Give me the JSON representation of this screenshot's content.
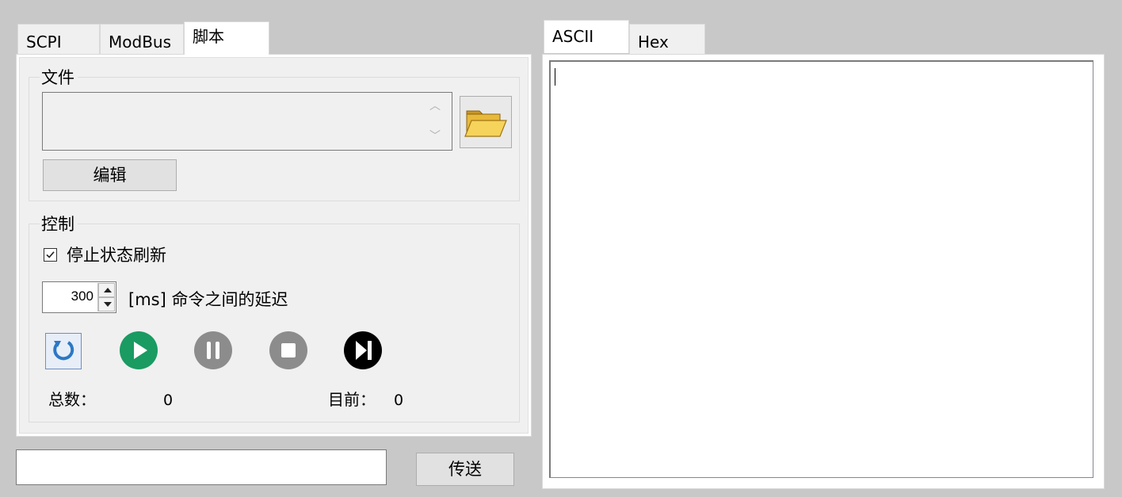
{
  "left_tabs": [
    {
      "label": "SCPI",
      "active": false
    },
    {
      "label": "ModBus",
      "active": false
    },
    {
      "label": "脚本",
      "active": true
    }
  ],
  "file_group": {
    "title": "文件",
    "file_value": "",
    "folder_icon": "folder-open-icon",
    "edit_label": "编辑"
  },
  "control_group": {
    "title": "控制",
    "stop_refresh": {
      "label": "停止状态刷新",
      "checked": true
    },
    "delay": {
      "value": "300",
      "label": "[ms] 命令之间的延迟"
    },
    "buttons": [
      {
        "name": "refresh-icon",
        "color": "#2b78c5"
      },
      {
        "name": "play-icon",
        "color": "#1a9b62"
      },
      {
        "name": "pause-icon",
        "color": "#8c8c8c"
      },
      {
        "name": "stop-icon",
        "color": "#8c8c8c"
      },
      {
        "name": "step-icon",
        "color": "#000000"
      }
    ],
    "total_label": "总数：",
    "total_value": "0",
    "current_label": "目前：",
    "current_value": "0"
  },
  "send": {
    "input_value": "",
    "button_label": "传送"
  },
  "right_tabs": [
    {
      "label": "ASCII",
      "active": true
    },
    {
      "label": "Hex",
      "active": false
    }
  ],
  "output_text": ""
}
